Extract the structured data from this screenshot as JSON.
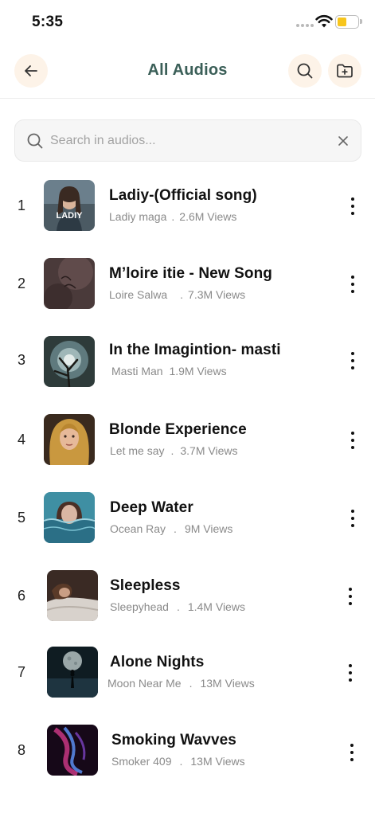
{
  "status_bar": {
    "time": "5:35"
  },
  "header": {
    "title": "All Audios",
    "back_icon": "arrow-left-icon",
    "search_icon": "search-icon",
    "folder_icon": "folder-add-icon"
  },
  "search": {
    "placeholder": "Search in audios...",
    "value": ""
  },
  "colors": {
    "title": "#3b5f58",
    "icon_bg": "#fdf3e8",
    "battery": "#f7c51c"
  },
  "tracks": [
    {
      "index": "1",
      "title": "Ladiy-(Official song)",
      "artist": "Ladiy maga",
      "views": "2.6M Views",
      "thumb_text": "LADIY"
    },
    {
      "index": "2",
      "title": "M’loire itie - New Song",
      "artist": "Loire Salwa",
      "views": "7.3M Views"
    },
    {
      "index": "3",
      "title": "In the Imagintion- masti",
      "artist": "Masti Man",
      "views": "1.9M Views"
    },
    {
      "index": "4",
      "title": "Blonde Experience",
      "artist": "Let me say",
      "views": "3.7M Views"
    },
    {
      "index": "5",
      "title": "Deep Water",
      "artist": "Ocean Ray",
      "views": "9M Views"
    },
    {
      "index": "6",
      "title": "Sleepless",
      "artist": "Sleepyhead",
      "views": "1.4M Views"
    },
    {
      "index": "7",
      "title": "Alone Nights",
      "artist": "Moon Near Me",
      "views": "13M Views"
    },
    {
      "index": "8",
      "title": "Smoking Wavves",
      "artist": "Smoker 409",
      "views": "13M Views"
    }
  ]
}
